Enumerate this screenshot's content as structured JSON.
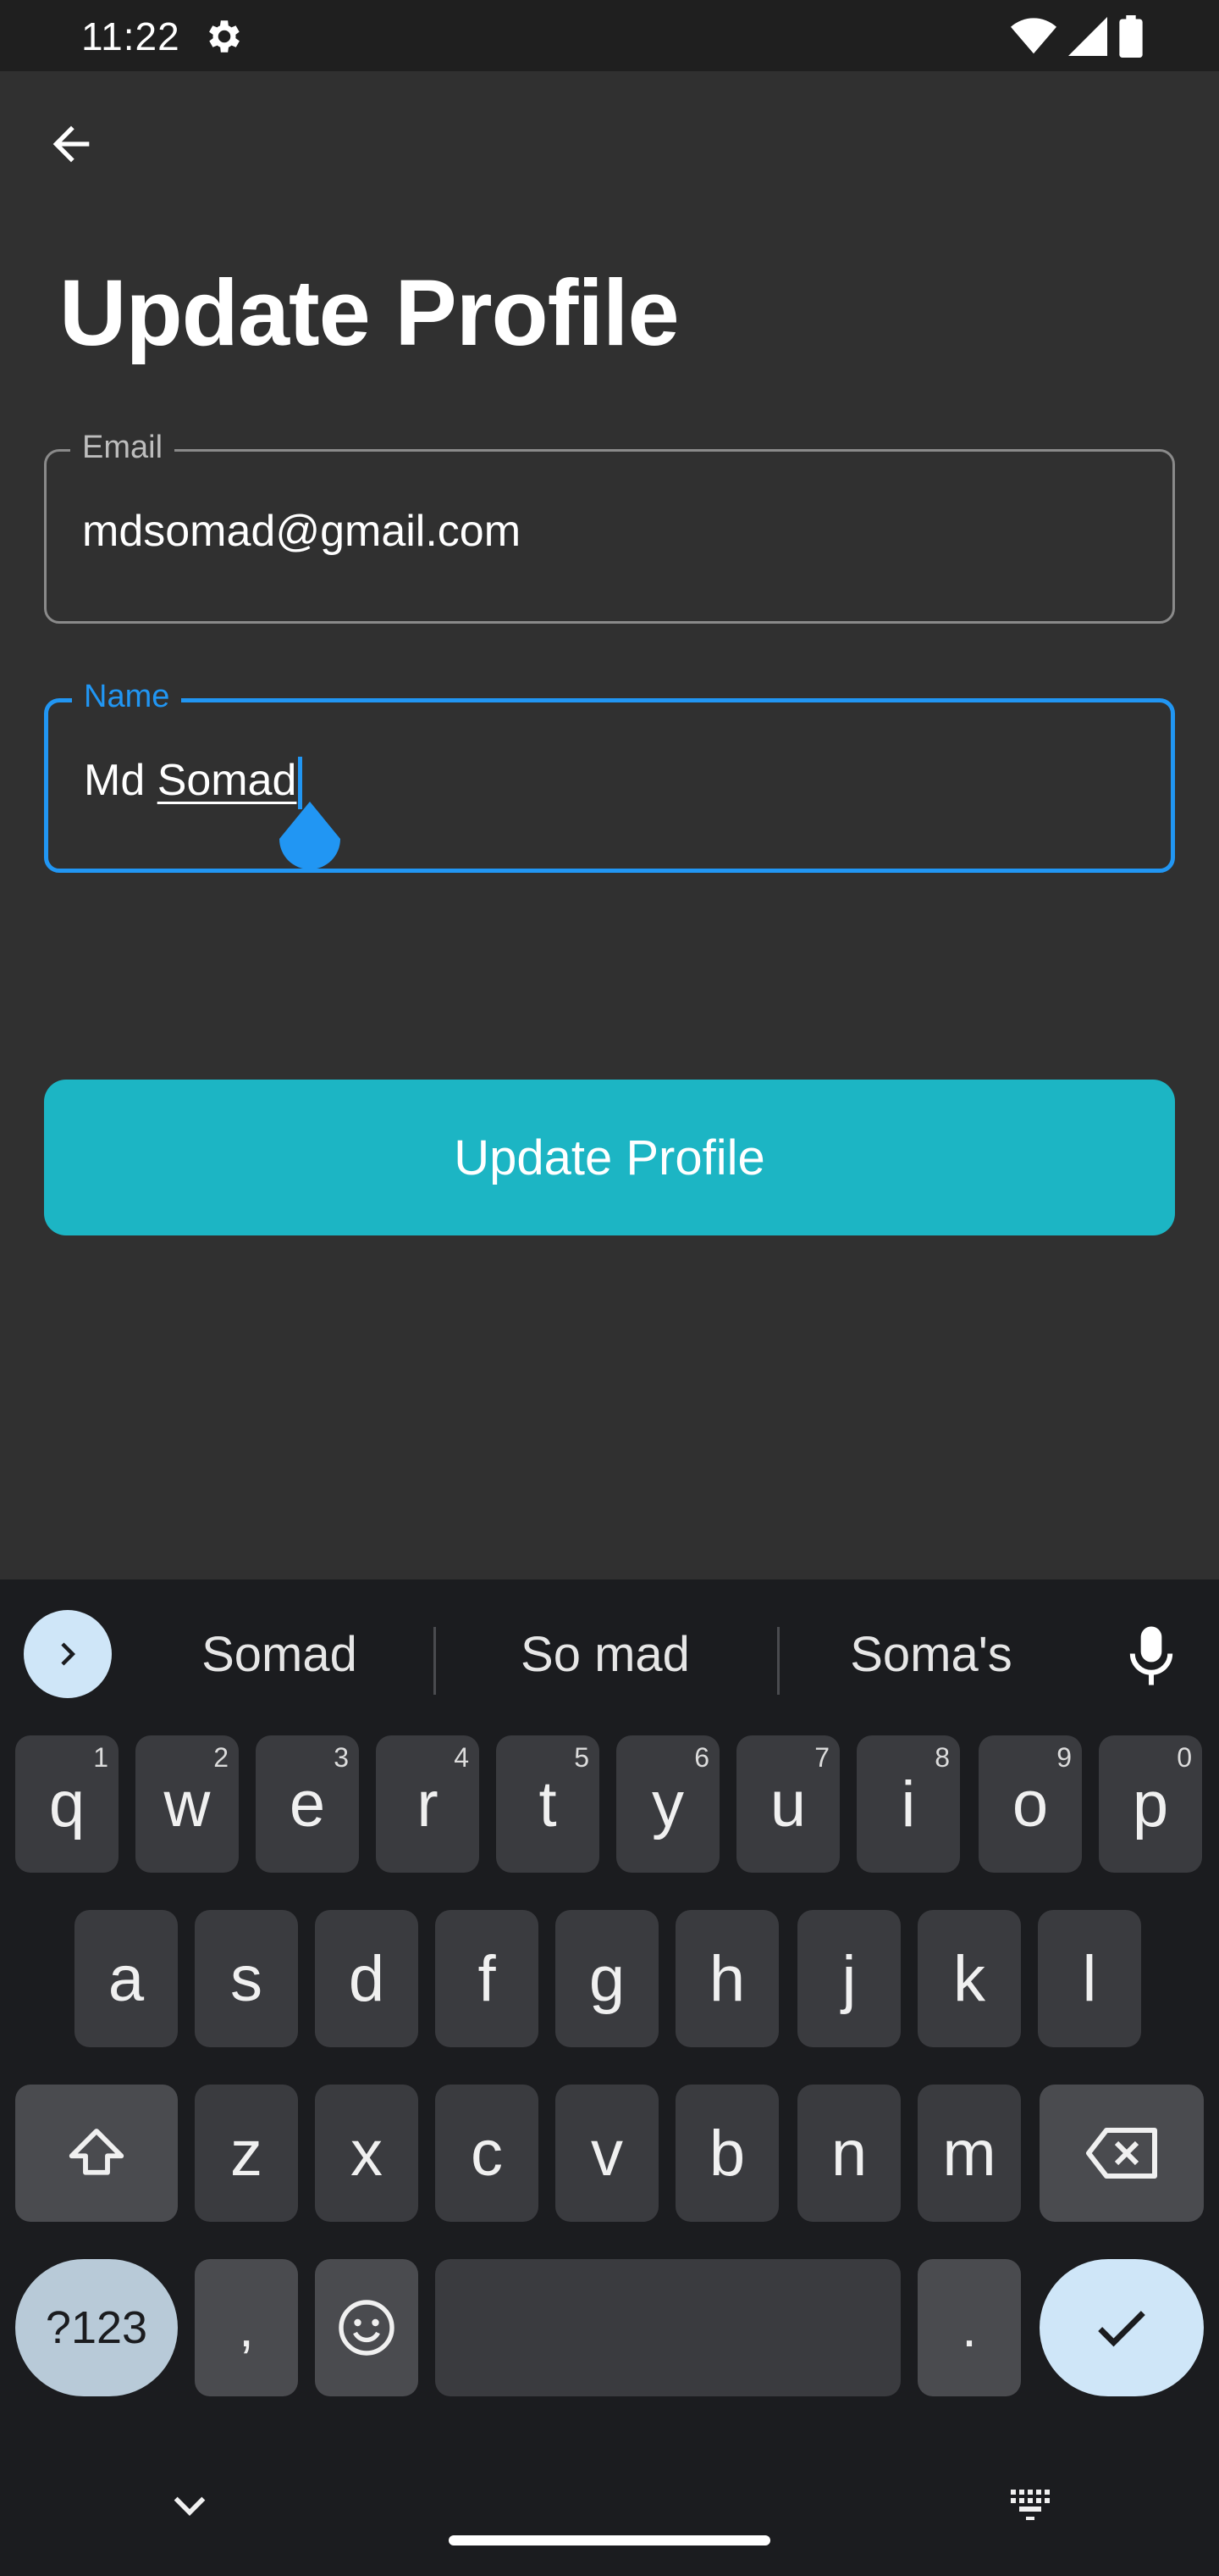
{
  "status_bar": {
    "time": "11:22",
    "icons": [
      "gear-icon",
      "wifi-icon",
      "signal-icon",
      "battery-icon"
    ]
  },
  "header": {
    "back_icon": "arrow-left-icon",
    "title": "Update Profile"
  },
  "form": {
    "email": {
      "label": "Email",
      "value": "mdsomad@gmail.com"
    },
    "name": {
      "label": "Name",
      "value_prefix": "Md ",
      "value_composing": "Somad",
      "focused": true
    }
  },
  "update_button": {
    "label": "Update Profile"
  },
  "keyboard": {
    "suggestions": [
      "Somad",
      "So mad",
      "Soma's"
    ],
    "row1": [
      {
        "k": "q",
        "h": "1"
      },
      {
        "k": "w",
        "h": "2"
      },
      {
        "k": "e",
        "h": "3"
      },
      {
        "k": "r",
        "h": "4"
      },
      {
        "k": "t",
        "h": "5"
      },
      {
        "k": "y",
        "h": "6"
      },
      {
        "k": "u",
        "h": "7"
      },
      {
        "k": "i",
        "h": "8"
      },
      {
        "k": "o",
        "h": "9"
      },
      {
        "k": "p",
        "h": "0"
      }
    ],
    "row2": [
      "a",
      "s",
      "d",
      "f",
      "g",
      "h",
      "j",
      "k",
      "l"
    ],
    "row3": [
      "z",
      "x",
      "c",
      "v",
      "b",
      "n",
      "m"
    ],
    "symbols_label": "?123",
    "comma_label": ",",
    "period_label": "."
  },
  "colors": {
    "accent_blue": "#2196f3",
    "button_teal": "#1cb5c4",
    "background": "#303030",
    "keyboard_bg": "#1b1c1f"
  }
}
